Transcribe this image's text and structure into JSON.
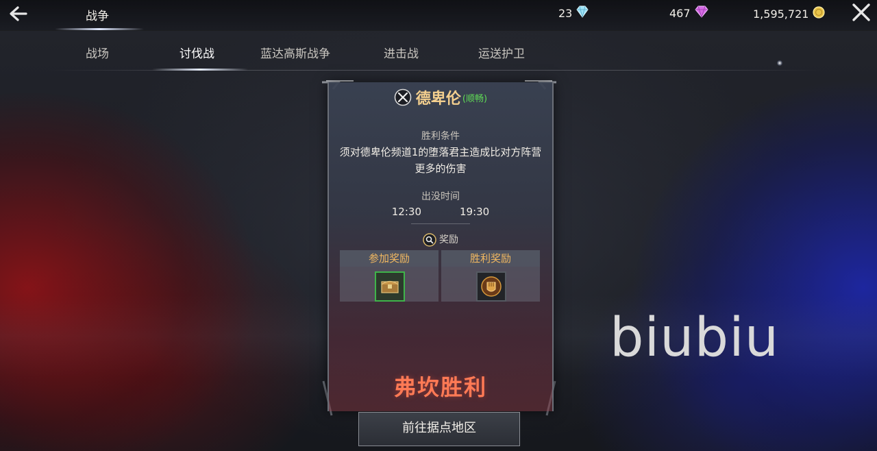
{
  "header": {
    "title": "战争",
    "currencies": [
      {
        "value": "23",
        "icon": "diamond-icon",
        "color": "#9ee3f7"
      },
      {
        "value": "467",
        "icon": "purple-gem-icon",
        "color": "#d66be6"
      },
      {
        "value": "1,595,721",
        "icon": "gold-coin-icon",
        "color": "#e9c44a"
      }
    ]
  },
  "tabs": [
    {
      "label": "战场",
      "active": false
    },
    {
      "label": "讨伐战",
      "active": true
    },
    {
      "label": "蓝达高斯战争",
      "active": false
    },
    {
      "label": "进击战",
      "active": false
    },
    {
      "label": "运送护卫",
      "active": false
    }
  ],
  "panel": {
    "name": "德卑伦",
    "status": "(顺畅)",
    "victory_condition_label": "胜利条件",
    "victory_condition_text": "须对德卑伦频道1的堕落君主造成比对方阵营更多的伤害",
    "spawn_time_label": "出没时间",
    "spawn_times": [
      "12:30",
      "19:30"
    ],
    "reward_label": "奖励",
    "participation_reward_label": "参加奖励",
    "victory_reward_label": "胜利奖励",
    "result": "弗坎胜利"
  },
  "go_button": "前往据点地区",
  "watermark": "biubiu"
}
